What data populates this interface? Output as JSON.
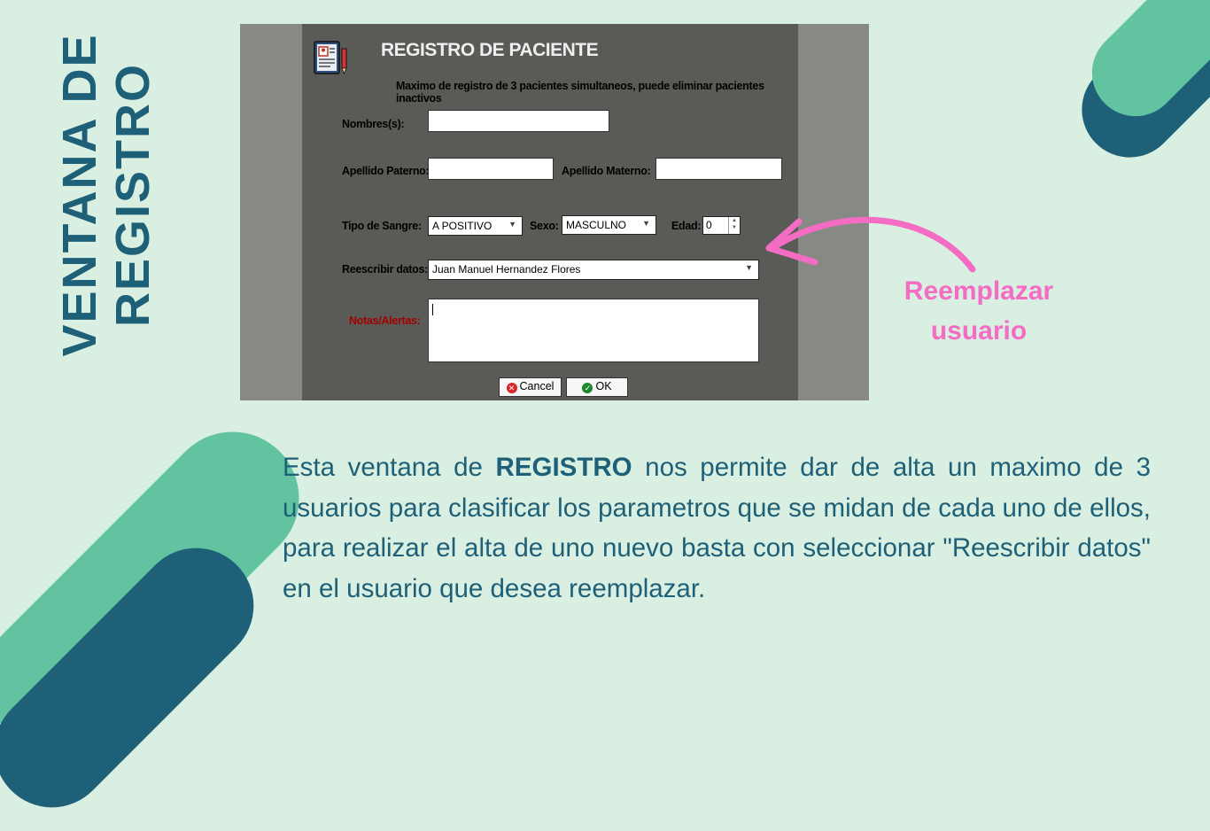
{
  "side_title": {
    "line1": "VENTANA DE",
    "line2": "REGISTRO"
  },
  "dialog": {
    "title": "REGISTRO DE PACIENTE",
    "subtitle": "Maximo de registro de 3 pacientes simultaneos, puede eliminar pacientes inactivos",
    "labels": {
      "nombres": "Nombres(s):",
      "apellido_paterno": "Apellido Paterno:",
      "apellido_materno": "Apellido Materno:",
      "tipo_sangre": "Tipo de Sangre:",
      "sexo": "Sexo:",
      "edad": "Edad:",
      "reescribir": "Reescribir datos:",
      "notas": "Notas/Alertas:"
    },
    "values": {
      "nombres": "",
      "apellido_paterno": "",
      "apellido_materno": "",
      "tipo_sangre": "A POSITIVO",
      "sexo": "MASCULNO",
      "edad": "0",
      "reescribir": "Juan Manuel Hernandez Flores",
      "notas": ""
    },
    "buttons": {
      "cancel": "Cancel",
      "ok": "OK"
    },
    "colors": {
      "notas_label": "#a20000",
      "cancel_icon": "#d9262b",
      "ok_icon": "#1e8a2e"
    }
  },
  "annotation": {
    "line1": "Reemplazar",
    "line2": "usuario",
    "color": "#f56cc4"
  },
  "description": {
    "before": "Esta ventana de ",
    "bold": "REGISTRO",
    "after": " nos permite dar de alta un maximo de 3 usuarios para clasificar los parametros que se midan de cada uno de ellos, para realizar el alta de uno nuevo basta con seleccionar \"Reescribir datos\" en el usuario que desea reemplazar."
  }
}
